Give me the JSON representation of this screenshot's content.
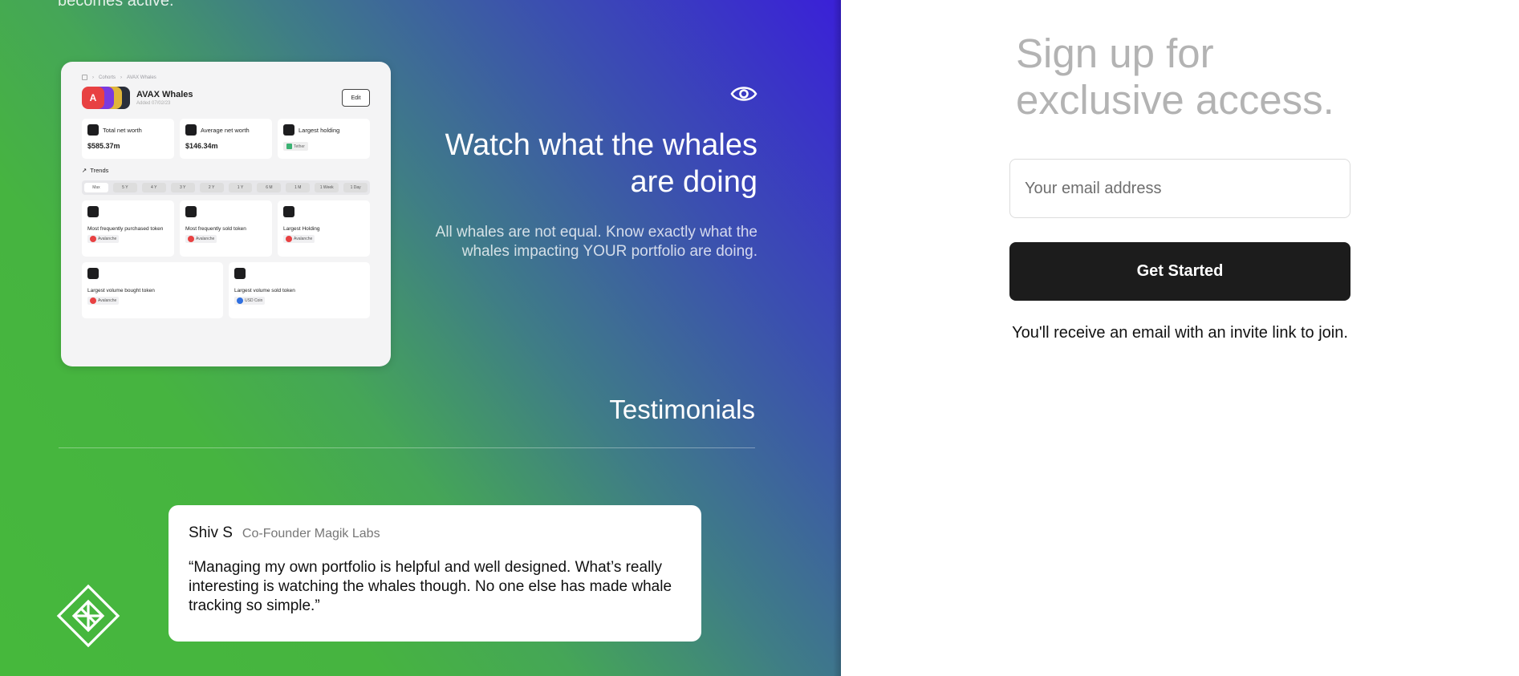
{
  "left": {
    "cut_text": "becomes active.",
    "dashboard": {
      "breadcrumb": [
        "Cohorts",
        "AVAX Whales"
      ],
      "title": "AVAX Whales",
      "subtitle": "Added 07/02/23",
      "edit_label": "Edit",
      "stats": [
        {
          "label": "Total net worth",
          "value": "$585.37m"
        },
        {
          "label": "Average net worth",
          "value": "$146.34m"
        },
        {
          "label": "Largest holding",
          "tag": "Tether"
        }
      ],
      "trends_label": "Trends",
      "timeframes": [
        "Max",
        "5 Y",
        "4 Y",
        "3 Y",
        "2 Y",
        "1 Y",
        "6 M",
        "1 M",
        "1 Week",
        "1 Day"
      ],
      "cards_row1": [
        {
          "label": "Most frequently purchased token",
          "chip": "Avalanche"
        },
        {
          "label": "Most frequently sold token",
          "chip": "Avalanche"
        },
        {
          "label": "Largest Holding",
          "chip": "Avalanche"
        }
      ],
      "cards_row2": [
        {
          "label": "Largest volume bought token",
          "chip": "Avalanche"
        },
        {
          "label": "Largest volume sold token",
          "chip": "USD Coin"
        }
      ]
    },
    "watch": {
      "title": "Watch what the whales are doing",
      "subtitle": "All whales are not equal. Know exactly what the whales impacting YOUR portfolio are doing."
    },
    "testimonials": {
      "title": "Testimonials",
      "items": [
        {
          "name": "Shiv S",
          "role": "Co-Founder Magik Labs",
          "quote": "“Managing my own portfolio is helpful and well designed. What’s really interesting is watching the whales though. No one else has made whale tracking so simple.”"
        }
      ]
    }
  },
  "right": {
    "title": "Sign up for exclusive access.",
    "email_placeholder": "Your email address",
    "cta_label": "Get Started",
    "note": "You'll receive an email with an invite link to join."
  },
  "colors": {
    "gradient_blue": "#3a20d8",
    "gradient_green": "#46b83c",
    "button_dark": "#1c1c1c",
    "title_gray": "#b3b3b3"
  }
}
